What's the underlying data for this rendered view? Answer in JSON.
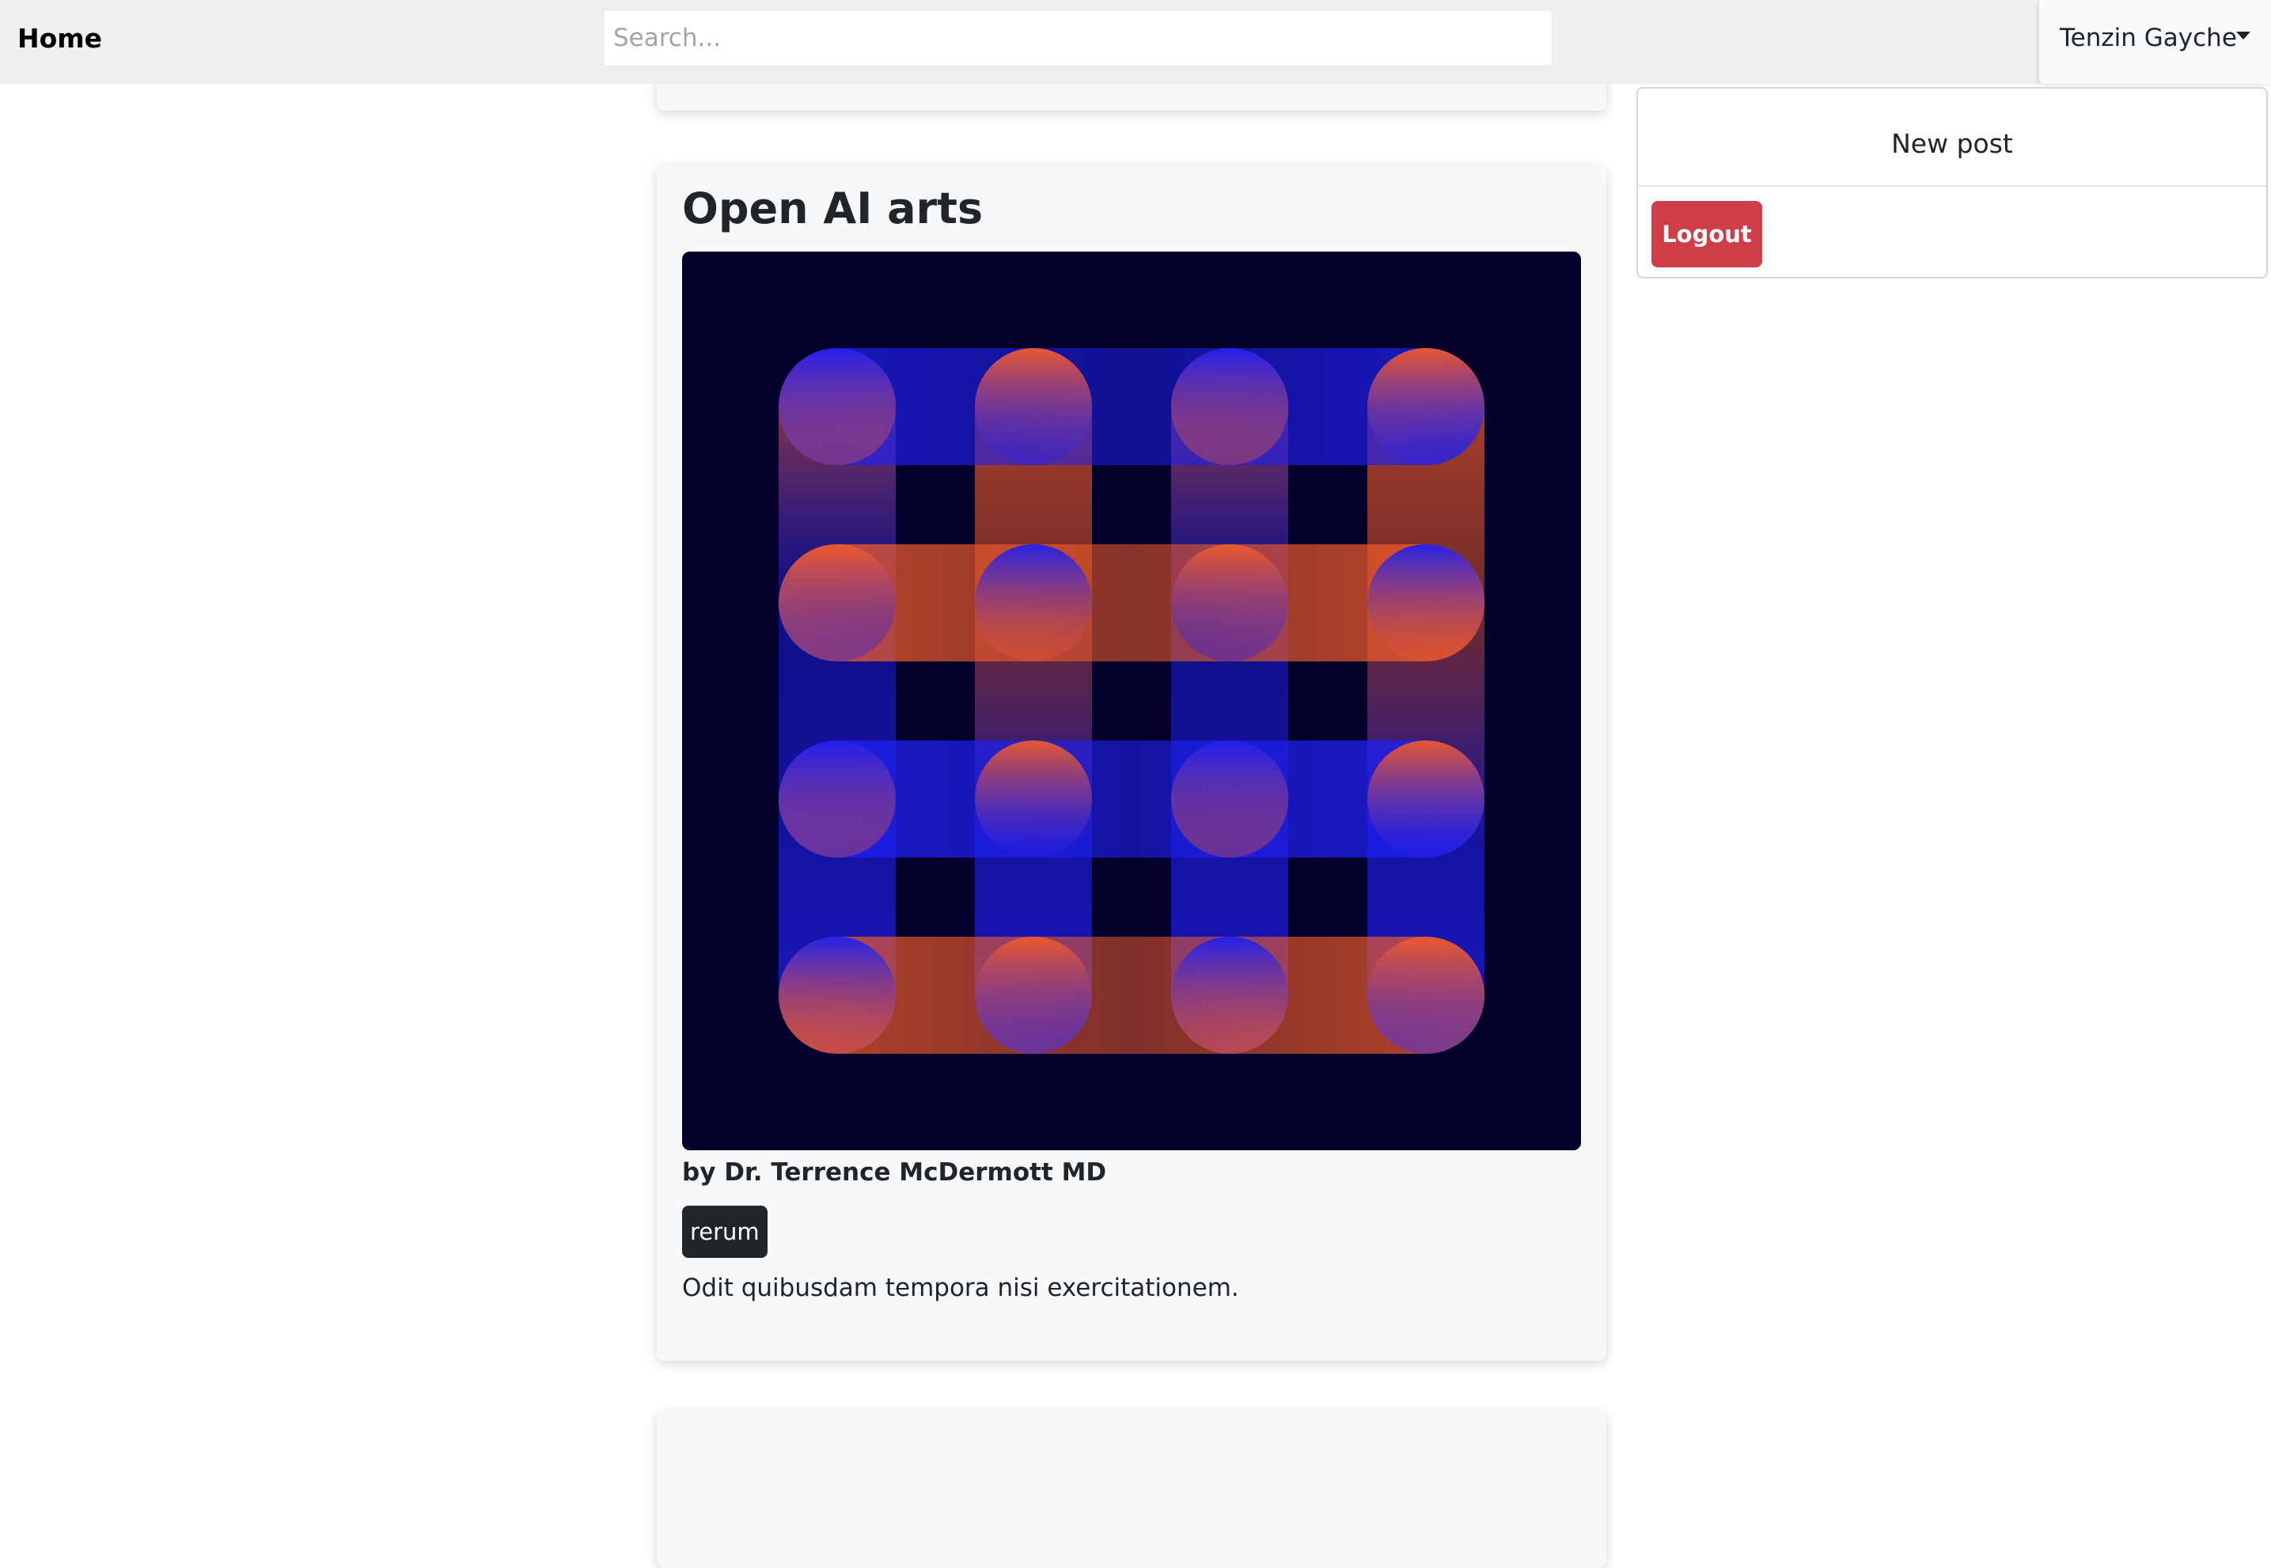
{
  "nav": {
    "brand": "Home",
    "search_placeholder": "Search..."
  },
  "user_menu": {
    "name": "Tenzin Gayche",
    "items": [
      "New post"
    ],
    "logout_label": "Logout"
  },
  "post": {
    "title": "Open AI arts",
    "author": "by Dr. Terrence McDermott MD",
    "tag": "rerum",
    "body": "Odit quibusdam tempora nisi exercitationem.",
    "image": {
      "background": "#03012b",
      "blue": "#1f1ff0",
      "orange": "#ef5a2a"
    }
  }
}
